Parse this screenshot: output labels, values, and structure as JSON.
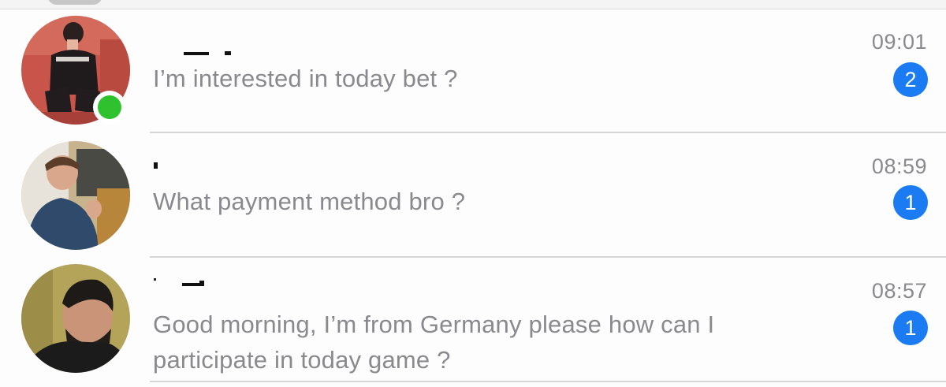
{
  "conversations": [
    {
      "preview": "I’m interested in today bet ?",
      "time": "09:01",
      "unread": "2",
      "online": true
    },
    {
      "preview": "What payment method bro ?",
      "time": "08:59",
      "unread": "1",
      "online": false
    },
    {
      "preview_line1": "Good morning, I’m from Germany please how can I",
      "preview_line2": "participate in today game ?",
      "time": "08:57",
      "unread": "1",
      "online": false
    }
  ],
  "colors": {
    "badge": "#1a7bf2",
    "online": "#2fc12e",
    "secondary_text": "#8a8a8e"
  }
}
